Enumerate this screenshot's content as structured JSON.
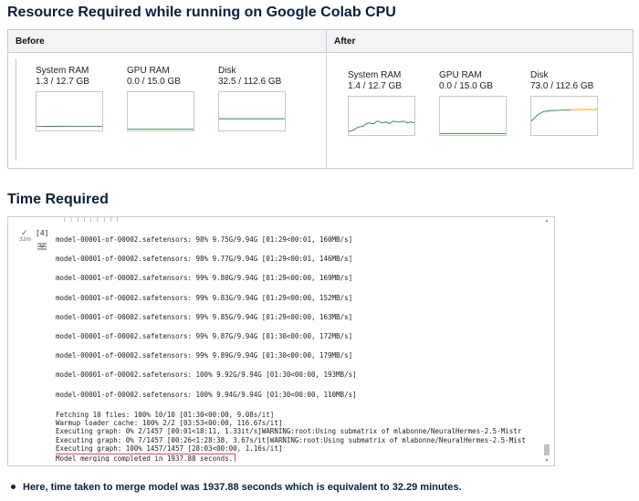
{
  "resource_heading": "Resource Required while running on Google Colab CPU",
  "table": {
    "before": {
      "header": "Before",
      "cards": [
        {
          "label": "System RAM",
          "value": "1.3 / 12.7 GB",
          "level": 0.1
        },
        {
          "label": "GPU RAM",
          "value": "0.0 / 15.0 GB",
          "level": 0.0
        },
        {
          "label": "Disk",
          "value": "32.5 / 112.6 GB",
          "level": 0.29
        }
      ]
    },
    "after": {
      "header": "After",
      "cards": [
        {
          "label": "System RAM",
          "value": "1.4 / 12.7 GB",
          "level": 0.11
        },
        {
          "label": "GPU RAM",
          "value": "0.0 / 15.0 GB",
          "level": 0.0
        },
        {
          "label": "Disk",
          "value": "73.0 / 112.6 GB",
          "level": 0.65
        }
      ]
    },
    "colors": {
      "line": "#2e8b3c",
      "disk_tail": "#f0a500"
    }
  },
  "time_heading": "Time Required",
  "output": {
    "cell_number": "[4]",
    "elapsed": "32m",
    "progress_lines": [
      "model-00001-of-00002.safetensors:  98% 9.75G/9.94G [01:29<00:01, 160MB/s]",
      "model-00001-of-00002.safetensors:  98% 9.77G/9.94G [01:29<00:01, 146MB/s]",
      "model-00001-of-00002.safetensors:  99% 9.80G/9.94G [01:29<00:00, 169MB/s]",
      "model-00001-of-00002.safetensors:  99% 9.83G/9.94G [01:29<00:00, 152MB/s]",
      "model-00001-of-00002.safetensors:  99% 9.85G/9.94G [01:29<00:00, 163MB/s]",
      "model-00001-of-00002.safetensors:  99% 9.87G/9.94G [01:30<00:00, 172MB/s]",
      "model-00001-of-00002.safetensors:  99% 9.89G/9.94G [01:30<00:00, 179MB/s]",
      "model-00001-of-00002.safetensors: 100% 9.92G/9.94G [01:30<00:00, 193MB/s]",
      "model-00001-of-00002.safetensors: 100% 9.94G/9.94G [01:30<00:00, 110MB/s]"
    ],
    "summary_lines": [
      "Fetching 10 files: 100% 10/10 [01:30<00:00,  9.08s/it]",
      "Warmup loader cache: 100% 2/2 [03:53<00:00, 116.67s/it]",
      "Executing graph:   0% 2/1457 [00:01<18:11,  1.33it/s]WARNING:root:Using submatrix of mlabonne/NeuralHermes-2.5-Mistr",
      "Executing graph:   0% 7/1457 [00:26<1:28:38,  3.67s/it]WARNING:root:Using submatrix of mlabonne/NeuralHermes-2.5-Mist",
      "Executing graph: 100% 1457/1457 [28:03<00:00,  1.16s/it]"
    ],
    "final_line": "Model merging completed in 1937.88 seconds."
  },
  "bullet": "Here, time taken to merge model was 1937.88 seconds which is equivalent to 32.29 minutes."
}
